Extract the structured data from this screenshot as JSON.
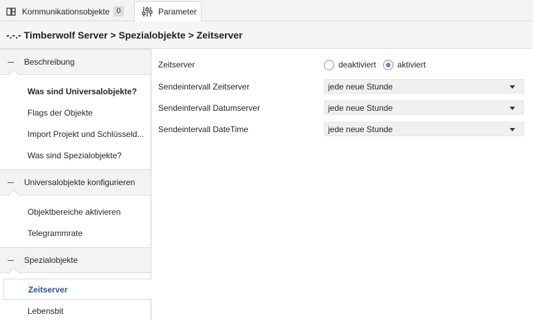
{
  "tabs": [
    {
      "label": "Kommunikationsobjekte",
      "badge": "0",
      "icon": "object-icon"
    },
    {
      "label": "Parameter",
      "icon": "sliders-icon"
    }
  ],
  "breadcrumb": "-.-.- Timberwolf Server > Spezialobjekte > Zeitserver",
  "sidebar": {
    "groups": [
      {
        "label": "Beschreibung",
        "items": [
          "Was sind Universalobjekte?",
          "Flags der Objekte",
          "Import Projekt und Schlüsseld...",
          "Was sind Spezialobjekte?"
        ]
      },
      {
        "label": "Universalobjekte konfigurieren",
        "items": [
          "Objektbereiche aktivieren",
          "Telegrammrate"
        ]
      },
      {
        "label": "Spezialobjekte",
        "items": [
          "Zeitserver",
          "Lebensbit"
        ]
      }
    ]
  },
  "params": {
    "zeitserver_label": "Zeitserver",
    "radio_off": "deaktiviert",
    "radio_on": "aktiviert",
    "selected": "aktiviert",
    "rows": [
      {
        "label": "Sendeintervall Zeitserver",
        "value": "jede neue Stunde"
      },
      {
        "label": "Sendeintervall Datumserver",
        "value": "jede neue Stunde"
      },
      {
        "label": "Sendeintervall DateTime",
        "value": "jede neue Stunde"
      }
    ]
  },
  "colors": {
    "accent": "#1a5a96",
    "radio_fill": "#6f8fb4"
  }
}
